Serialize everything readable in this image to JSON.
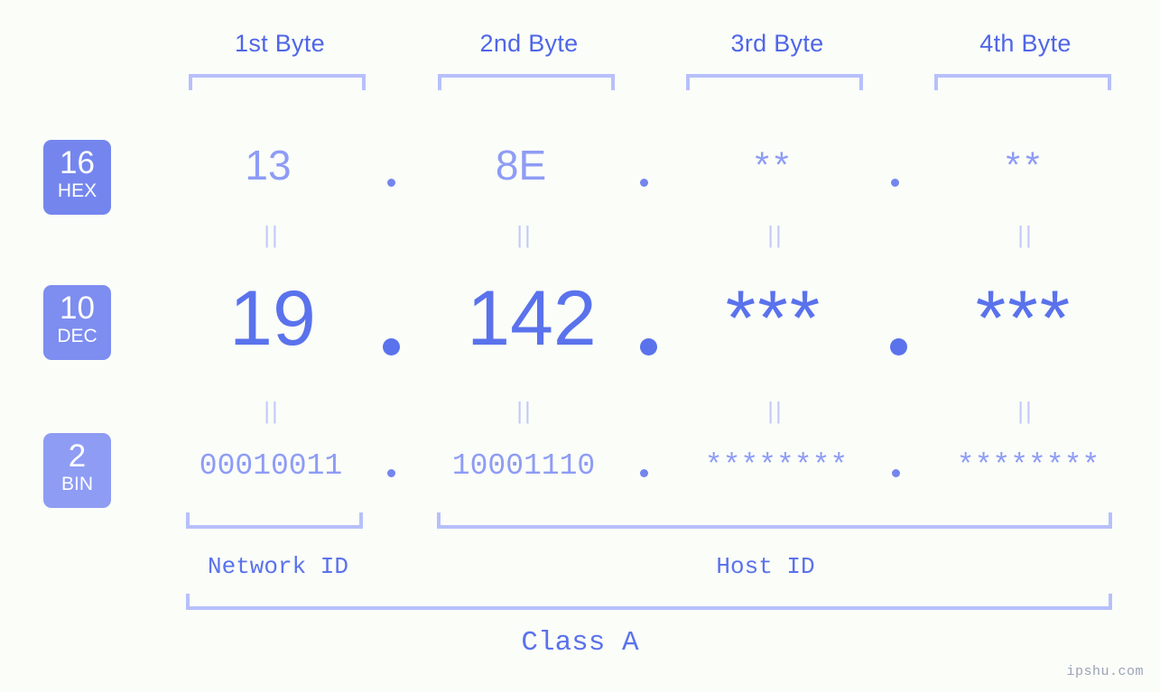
{
  "page": {
    "background_color": "#fbfdf9",
    "accent_color": "#5a72ec",
    "accent_light_color": "#8e9cf5",
    "bracket_color": "#b7c0fb",
    "watermark": "ipshu.com"
  },
  "byte_headers": [
    {
      "label": "1st Byte"
    },
    {
      "label": "2nd Byte"
    },
    {
      "label": "3rd Byte"
    },
    {
      "label": "4th Byte"
    }
  ],
  "bases": [
    {
      "radix": "16",
      "name": "HEX",
      "color": "#7486ee"
    },
    {
      "radix": "10",
      "name": "DEC",
      "color": "#7d8df0"
    },
    {
      "radix": "2",
      "name": "BIN",
      "color": "#8e9cf4"
    }
  ],
  "rows": {
    "hex": {
      "values": [
        "13",
        "8E",
        "**",
        "**"
      ]
    },
    "dec": {
      "values": [
        "19",
        "142",
        "***",
        "***"
      ]
    },
    "bin": {
      "values": [
        "00010011",
        "10001110",
        "********",
        "********"
      ]
    }
  },
  "separators": {
    "dot": ".",
    "equals": "||"
  },
  "id_sections": [
    {
      "label": "Network ID"
    },
    {
      "label": "Host ID"
    }
  ],
  "class": {
    "label": "Class A"
  }
}
